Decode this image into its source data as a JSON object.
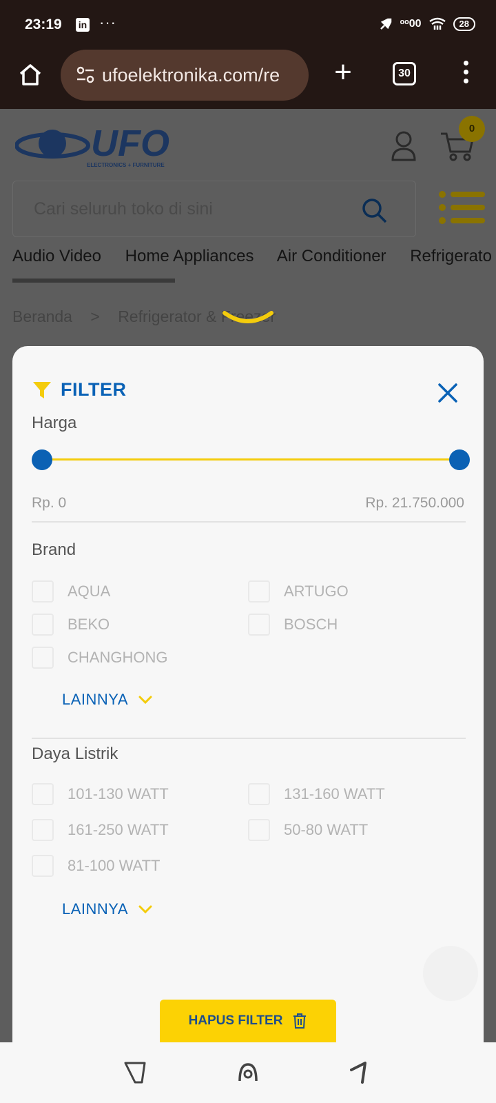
{
  "status_bar": {
    "time": "23:19",
    "app_icon": "in",
    "more": "···",
    "signal": "ᵒᵒ00",
    "battery": "28"
  },
  "browser": {
    "url": "ufoelektronika.com/re",
    "tab_count": "30"
  },
  "site": {
    "logo_text": "UFO",
    "logo_sub": "ELECTRONICS + FURNITURE",
    "cart_count": "0",
    "search_placeholder": "Cari seluruh toko di sini",
    "nav": [
      "Audio Video",
      "Home Appliances",
      "Air Conditioner",
      "Refrigerato"
    ],
    "breadcrumb": [
      "Beranda",
      ">",
      "Refrigerator & Freezer"
    ]
  },
  "filter": {
    "title": "FILTER",
    "price": {
      "label": "Harga",
      "min": "Rp. 0",
      "max": "Rp. 21.750.000",
      "range_low_fraction": 0,
      "range_high_fraction": 1
    },
    "brand": {
      "label": "Brand",
      "options": [
        "AQUA",
        "ARTUGO",
        "BEKO",
        "BOSCH",
        "CHANGHONG"
      ],
      "more": "LAINNYA"
    },
    "power": {
      "label": "Daya Listrik",
      "options": [
        "101-130 WATT",
        "131-160 WATT",
        "161-250 WATT",
        "50-80 WATT",
        "81-100 WATT"
      ],
      "more": "LAINNYA"
    },
    "clear_label": "HAPUS FILTER"
  },
  "colors": {
    "accent_blue": "#0b61b4",
    "accent_yellow": "#fcd204"
  }
}
